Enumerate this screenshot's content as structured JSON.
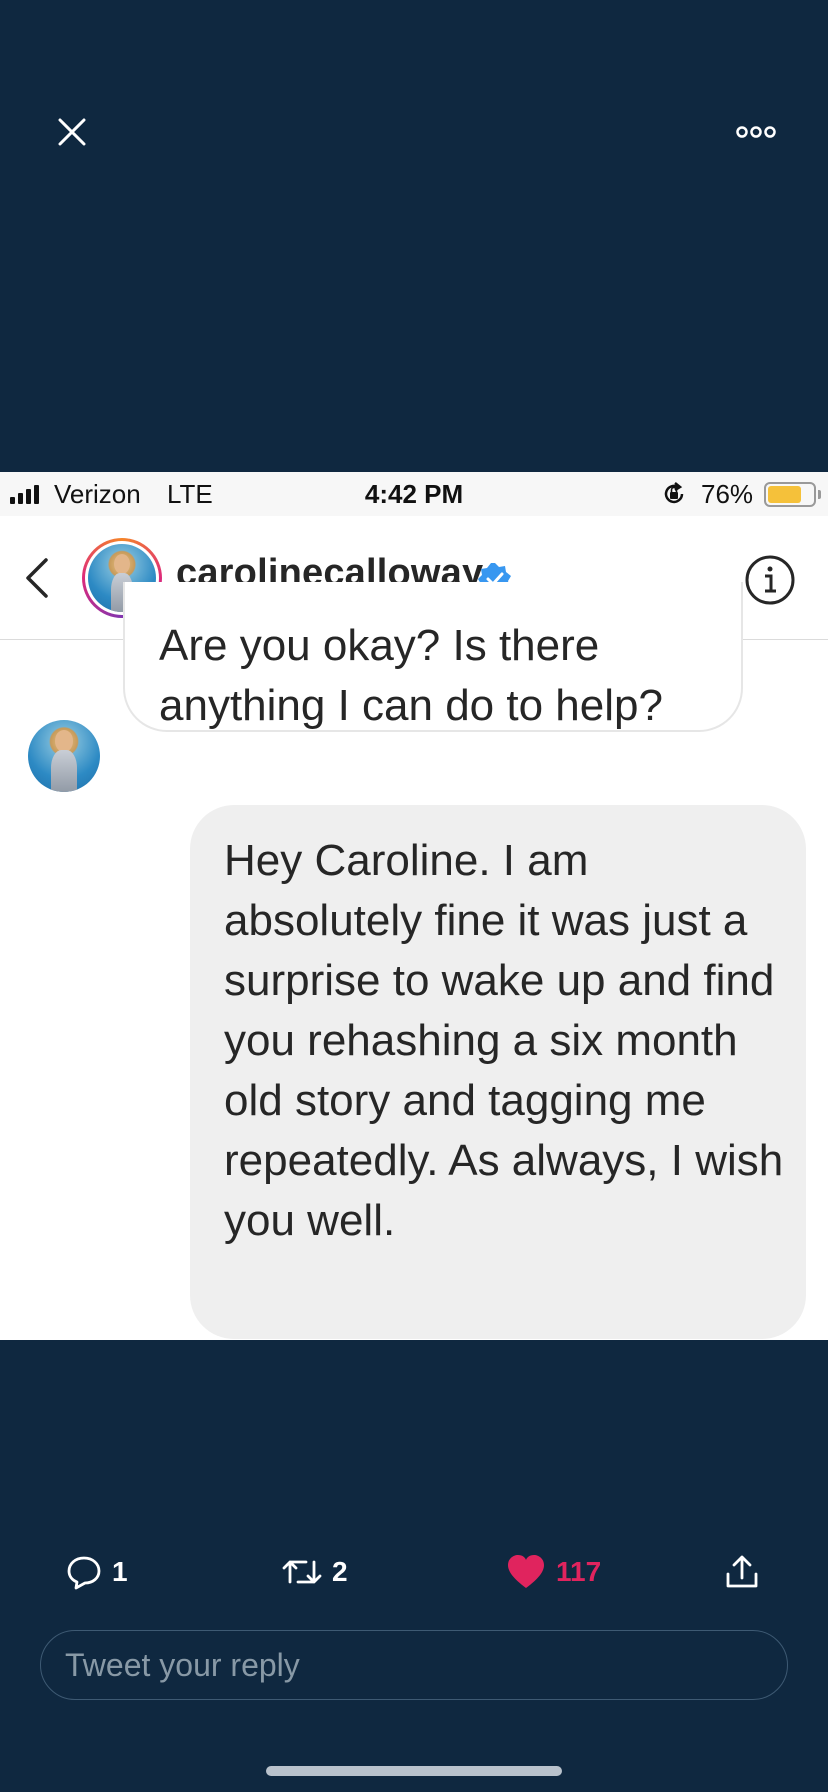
{
  "top_bar": {
    "close_icon": "close-icon",
    "more_icon": "more-dots-icon"
  },
  "status_bar": {
    "carrier": "Verizon",
    "network": "LTE",
    "time": "4:42 PM",
    "battery": "76%",
    "battery_level": 0.76
  },
  "chat": {
    "username": "carolinecalloway",
    "verified": true,
    "incoming_message": "Are you okay? Is there anything I can do to help?",
    "outgoing_message": "Hey Caroline. I am absolutely fine it was just a surprise to wake up and find you rehashing a six month old story and tagging me repeatedly. As always, I wish you well."
  },
  "actions": {
    "replies": "1",
    "retweets": "2",
    "likes": "117"
  },
  "reply_box": {
    "placeholder": "Tweet your reply"
  },
  "colors": {
    "background": "#0f2840",
    "like": "#e0245e",
    "verified": "#3897f0",
    "battery": "#f5c13a"
  }
}
